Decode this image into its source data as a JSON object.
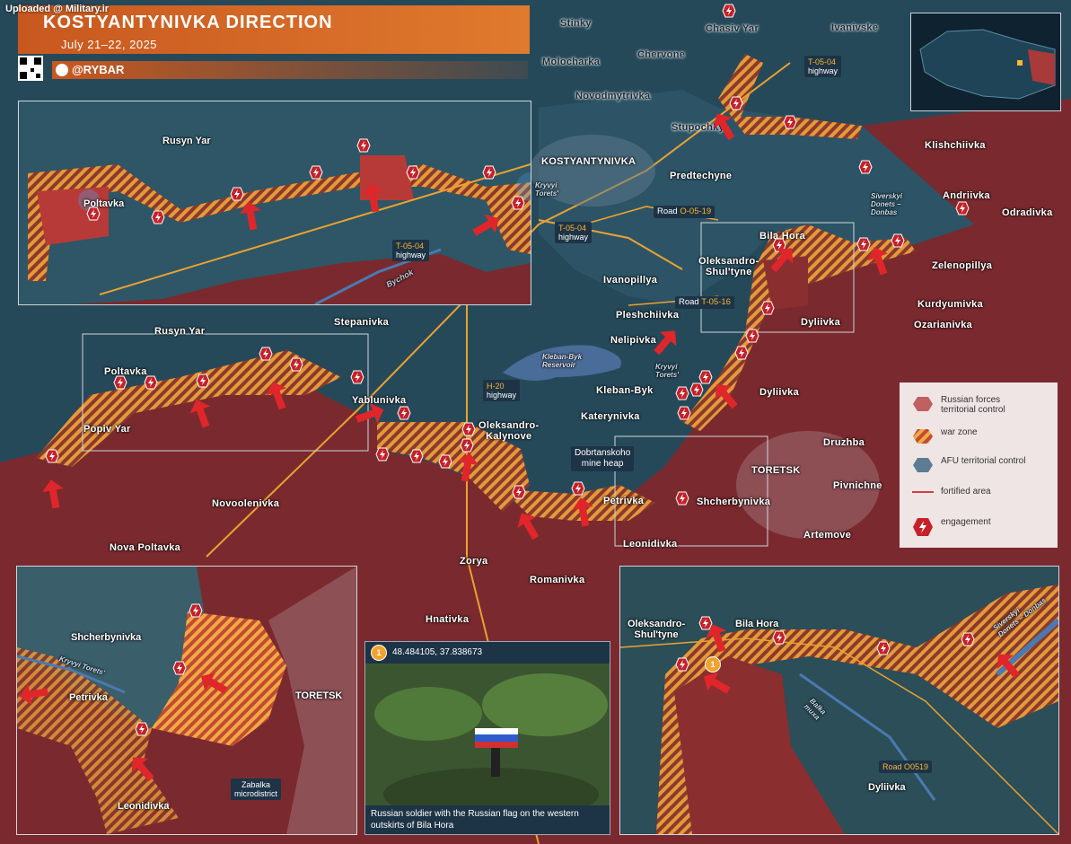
{
  "header": {
    "uploaded": "Uploaded @ Military.ir",
    "title": "KOSTYANTYNIVKA DIRECTION",
    "date": "July 21–22, 2025",
    "brand": "@RYBAR"
  },
  "colors": {
    "russian": "#7a2a2e",
    "afu": "#25495a",
    "warzone_orange": "#e49a3a",
    "fortified": "#e04848",
    "engagement": "#c4222a",
    "title_orange": "#d06a27",
    "road_box": "#1d3346"
  },
  "main_settlements": [
    "Stinky",
    "Chasiv Yar",
    "Ivanivske",
    "Molocharka",
    "Chervone",
    "Novodmytrivka",
    "Stupochky",
    "Klishchiivka",
    "KOSTYANTYNIVKA",
    "Predtechyne",
    "Andriivka",
    "Odradivka",
    "Bila Hora",
    "Oleksandro-\nShul'tyne",
    "Zelenopillya",
    "Ivanopillya",
    "Kurdyumivka",
    "Pleshchiivka",
    "Dyliivka",
    "Ozarianivka",
    "Nelipivka",
    "Stepanivka",
    "Rusyn Yar",
    "Poltavka",
    "Yablunivka",
    "Kleban-Byk",
    "Dyliivka",
    "Popiv Yar",
    "Katerynivka",
    "Oleksandro-\nKalynove",
    "Druzhba",
    "Dobrtanskoho\nmine heap",
    "TORETSK",
    "Pivnichne",
    "Novoolenivka",
    "Petrivka",
    "Shcherbynivka",
    "Nova Poltavka",
    "Leonidivka",
    "Artemove",
    "Zorya",
    "Romanivka",
    "Hnativka"
  ],
  "roads": [
    {
      "prefix": "",
      "code": "T-05-04",
      "suffix": "highway"
    },
    {
      "prefix": "Road ",
      "code": "O-05-19",
      "suffix": ""
    },
    {
      "prefix": "",
      "code": "T-05-04",
      "suffix": "highway"
    },
    {
      "prefix": "Road ",
      "code": "T-05-16",
      "suffix": ""
    },
    {
      "prefix": "",
      "code": "H-20",
      "suffix": "highway"
    }
  ],
  "water_labels": [
    "Kryvyi\nTorets'",
    "Kleban-Byk\nReservoir",
    "Kryvyi\nTorets'",
    "Siverskyi\nDonets –\nDonbas"
  ],
  "inset_tl": {
    "places": [
      "Rusyn Yar",
      "Poltavka"
    ],
    "road": {
      "code": "T-05-04",
      "suffix": "highway"
    },
    "river": "Bychok"
  },
  "inset_bl": {
    "places": [
      "Shcherbynivka",
      "Petrivka",
      "TORETSK",
      "Leonidivka"
    ],
    "river": "Kryvyi Torets'",
    "micro": "Zabalka\nmicrodistrict"
  },
  "inset_br": {
    "places": [
      "Oleksandro-\nShul'tyne",
      "Bila Hora",
      "Dyliivka"
    ],
    "road": "Road O0519",
    "river": "Balka\nmuxa",
    "canal": "Siverskyi\nDonets – Donbas"
  },
  "photo": {
    "marker": "1",
    "coords": "48.484105, 37.838673",
    "caption": "Russian soldier with the Russian flag on the western outskirts of Bila Hora"
  },
  "legend": {
    "items": [
      {
        "label": "Russian forces\nterritorial control",
        "icon": "russian-control-icon"
      },
      {
        "label": "war zone",
        "icon": "war-zone-icon"
      },
      {
        "label": "AFU territorial control",
        "icon": "afu-control-icon"
      },
      {
        "label": "fortified area",
        "icon": "fortified-line-icon"
      },
      {
        "label": "engagement",
        "icon": "engagement-icon"
      }
    ]
  },
  "watermark": "@RYBAR"
}
